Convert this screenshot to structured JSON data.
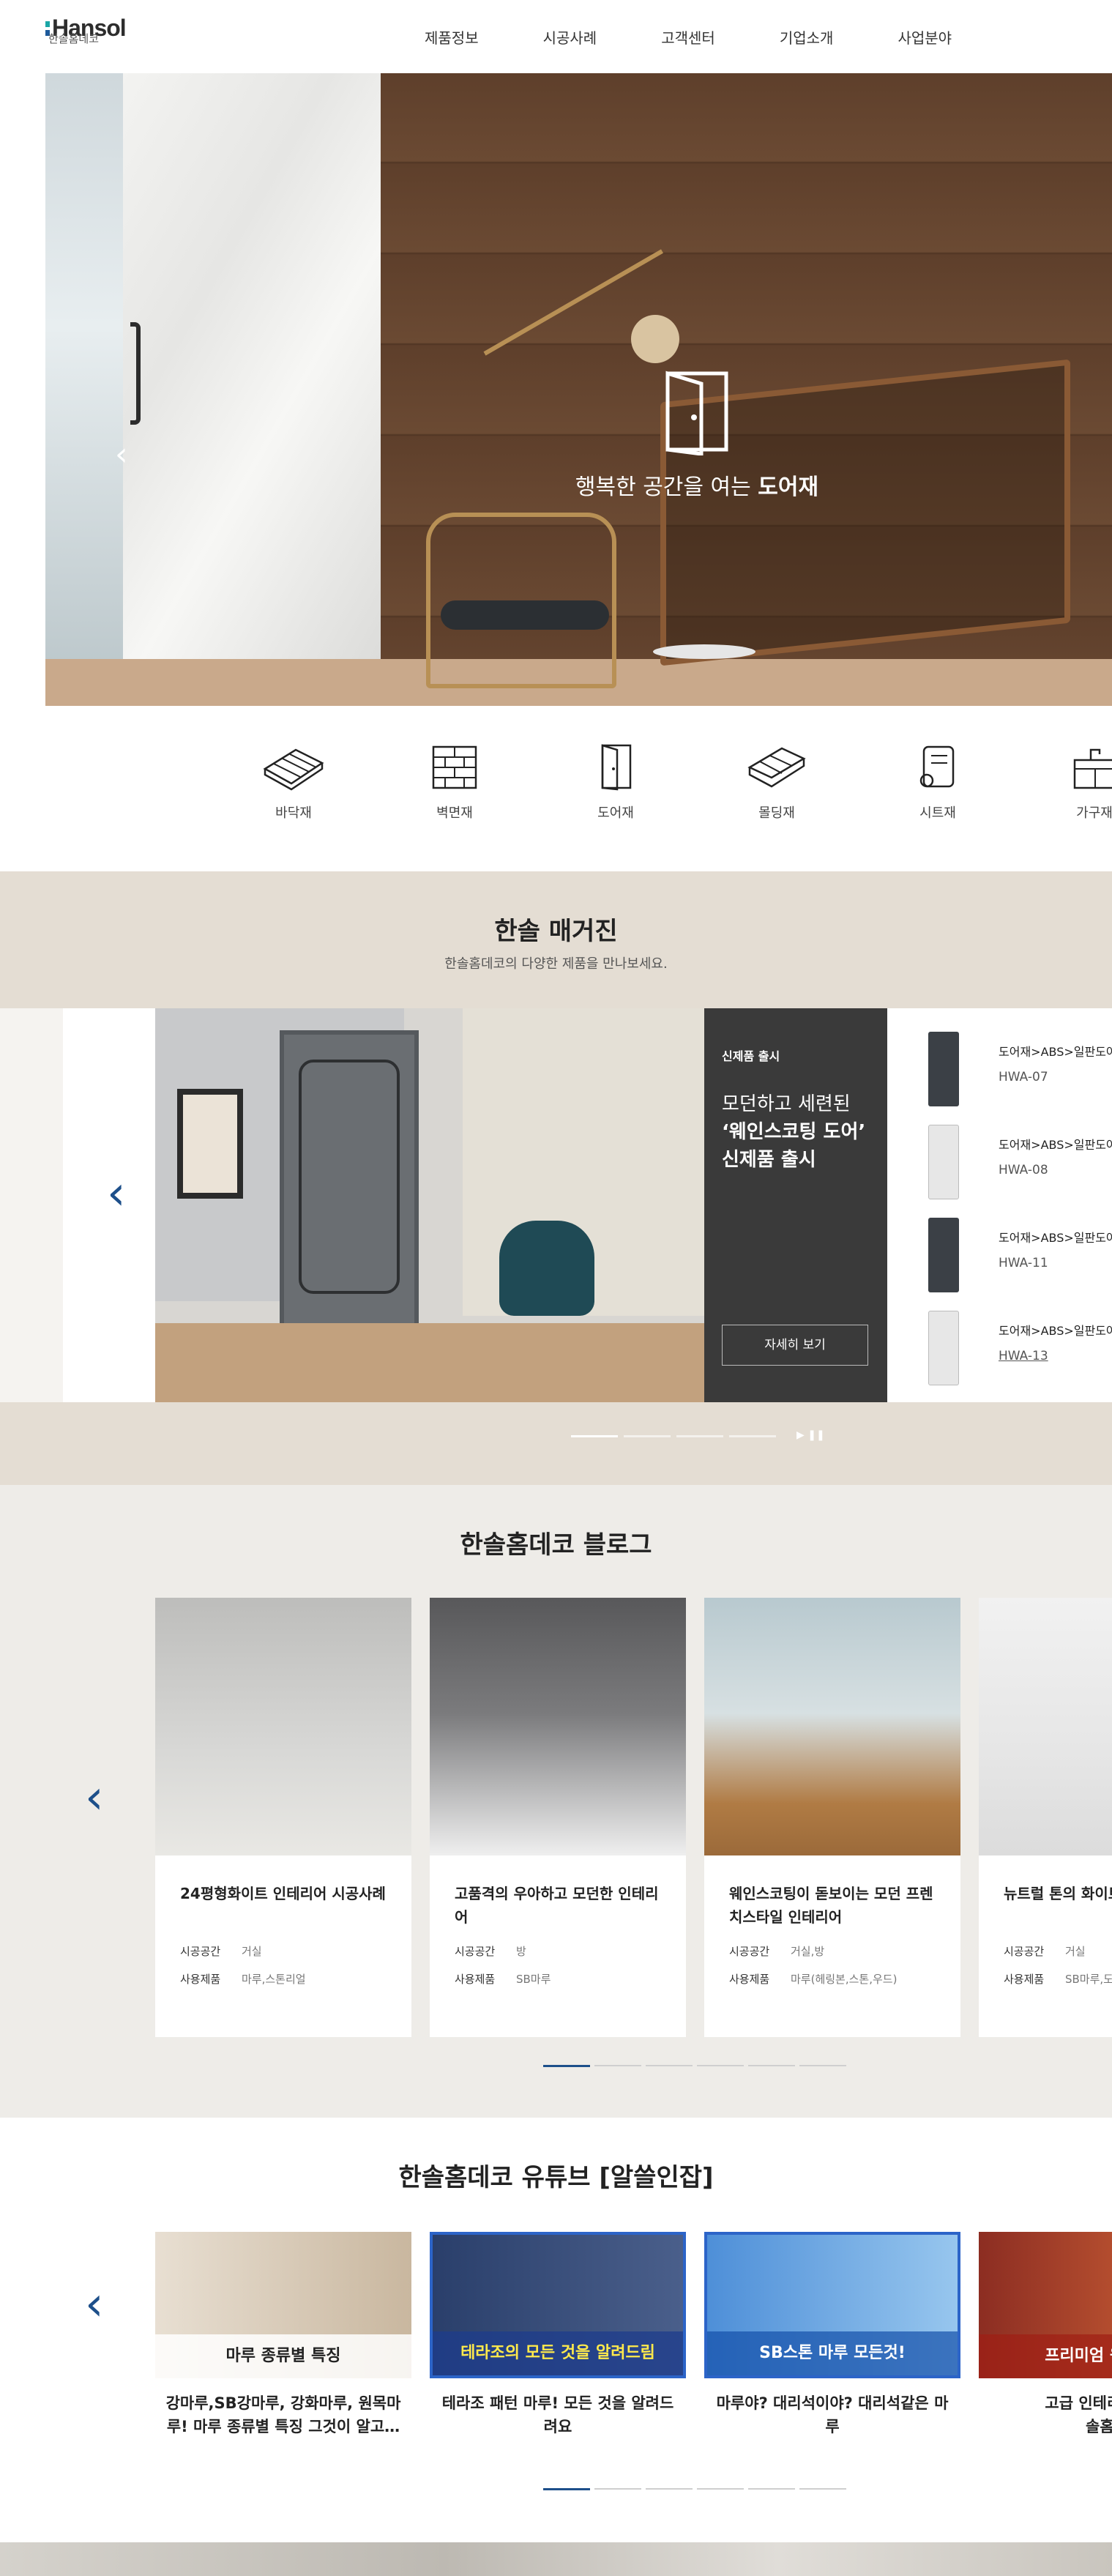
{
  "header": {
    "logo_text": "Hansol",
    "logo_sub": "한솔홈데코",
    "nav": [
      "제품정보",
      "시공사례",
      "고객센터",
      "기업소개",
      "사업분야"
    ]
  },
  "hero": {
    "caption_prefix": "행복한 공간을 여는 ",
    "caption_strong": "도어재",
    "prev_symbol": "‹",
    "pager_controls": "❚❚"
  },
  "categories": [
    {
      "label": "바닥재",
      "icon": "floor-icon"
    },
    {
      "label": "벽면재",
      "icon": "brick-wall-icon"
    },
    {
      "label": "도어재",
      "icon": "door-icon"
    },
    {
      "label": "몰딩재",
      "icon": "molding-icon"
    },
    {
      "label": "시트재",
      "icon": "sheet-roll-icon"
    },
    {
      "label": "가구재",
      "icon": "sink-icon"
    }
  ],
  "magazine": {
    "title": "한솔 매거진",
    "subtitle": "한솔홈데코의 다양한 제품을 만나보세요.",
    "badge": "신제품 출시",
    "headline_1": "모던하고 세련된",
    "headline_2": "‘웨인스코팅 도어’",
    "headline_3": "신제품 출시",
    "more_label": "자세히 보기",
    "prev_symbol": "‹",
    "pager_controls": "▶ ❚❚",
    "products": [
      {
        "path": "도어재>ABS>일판도어",
        "code": "HWA-07"
      },
      {
        "path": "도어재>ABS>일판도어",
        "code": "HWA-08"
      },
      {
        "path": "도어재>ABS>일판도어",
        "code": "HWA-11"
      },
      {
        "path": "도어재>ABS>일판도어",
        "code": "HWA-13"
      }
    ]
  },
  "blog": {
    "title": "한솔홈데코 블로그",
    "prev_symbol": "‹",
    "space_label": "시공공간",
    "product_label": "사용제품",
    "cards": [
      {
        "title": "24평형화이트 인테리어 시공사례",
        "space": "거실",
        "product": "마루,스톤리얼"
      },
      {
        "title": "고품격의 우아하고 모던한 인테리어",
        "space": "방",
        "product": "SB마루"
      },
      {
        "title": "웨인스코팅이 돋보이는 모던 프렌치스타일 인테리어",
        "space": "거실,방",
        "product": "마루(헤링본,스톤,우드)"
      },
      {
        "title": "뉴트럴 톤의 화이트",
        "space": "거실",
        "product": "SB마루,도"
      }
    ]
  },
  "youtube": {
    "title": "한솔홈데코 유튜브 [알쓸인잡]",
    "prev_symbol": "‹",
    "videos": [
      {
        "thumb_text": "마루 종류별 특징",
        "title": "강마루,SB강마루, 강화마루, 원목마\n루! 마루 종류별 특징 그것이 알고…"
      },
      {
        "thumb_text": "테라조의 모든 것을 알려드림",
        "title": "테라조 패턴 마루! 모든 것을 알려드\n려요"
      },
      {
        "thumb_text": "SB스톤 마루 모든것!",
        "title": "마루야? 대리석이야? 대리석같은 마\n루"
      },
      {
        "thumb_text": "프리미엄 원목마루",
        "title": "고급 인테리어를 위\n솔홈데"
      }
    ]
  }
}
